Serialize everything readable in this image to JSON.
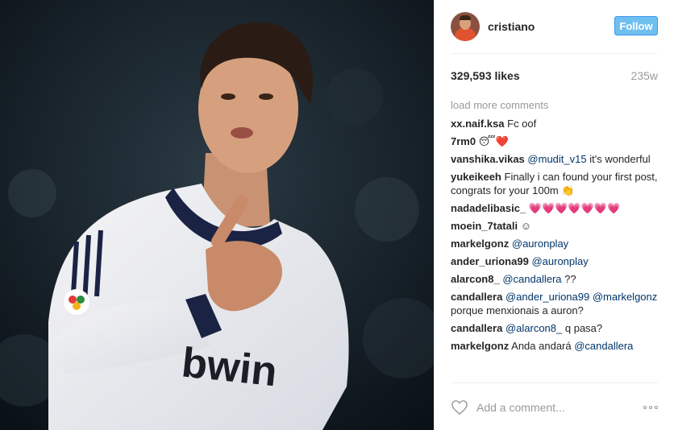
{
  "post": {
    "username": "cristiano",
    "follow_label": "Follow",
    "likes": "329,593 likes",
    "age": "235w",
    "load_more": "load more comments",
    "add_comment_placeholder": "Add a comment...",
    "photo_text": "bwin"
  },
  "comments": [
    {
      "user": "xx.naif.ksa",
      "text": "Fc oof"
    },
    {
      "user": "7rm0",
      "text": "😴❤️"
    },
    {
      "user": "vanshika.vikas",
      "mention": "@mudit_v15",
      "text": "it's wonderful"
    },
    {
      "user": "yukeikeeh",
      "text": "Finally i can found your first post, congrats for your 100m 👏"
    },
    {
      "user": "nadadelibasic_",
      "text": "💗💗💗💗💗💗💗"
    },
    {
      "user": "moein_7tatali",
      "text": "☺"
    },
    {
      "user": "markelgonz",
      "mention": "@auronplay",
      "text": ""
    },
    {
      "user": "ander_uriona99",
      "mention": "@auronplay",
      "text": ""
    },
    {
      "user": "alarcon8_",
      "mention": "@candallera",
      "text": "??"
    },
    {
      "user": "candallera",
      "mention": "@ander_uriona99",
      "mention2": "@markelgonz",
      "text": "porque menxionais a auron?"
    },
    {
      "user": "candallera",
      "mention": "@alarcon8_",
      "text": "q pasa?"
    },
    {
      "user": "markelgonz",
      "pre": "Anda andará",
      "mention": "@candallera",
      "text": ""
    }
  ],
  "colors": {
    "follow_bg": "#70c0ef",
    "mention": "#003569",
    "muted": "#999999"
  },
  "icons": {
    "heart": "heart-outline-icon",
    "more": "more-options-icon"
  }
}
